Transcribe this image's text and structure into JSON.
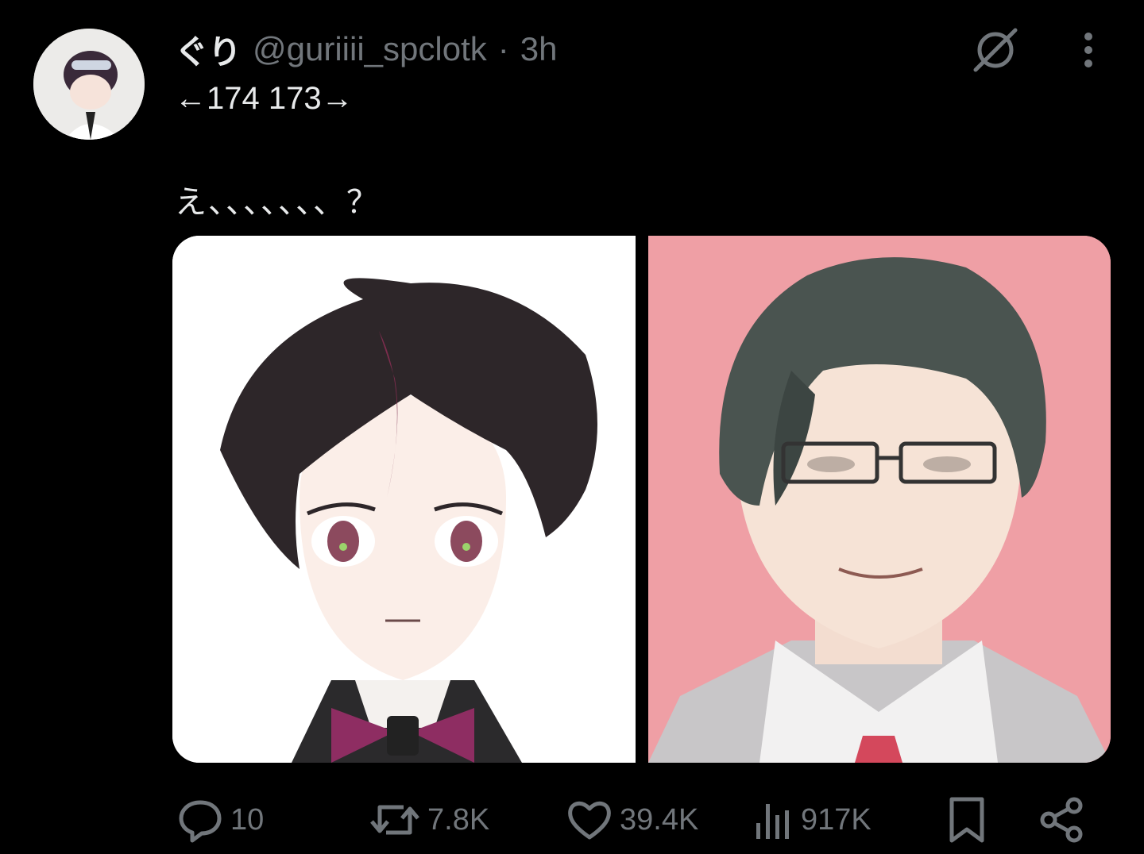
{
  "tweet": {
    "author_name": "ぐり",
    "handle": "@guriiii_spclotk",
    "separator": "·",
    "time": "3h",
    "line1": "←174 173→",
    "line2": "え、、、、、、、？"
  },
  "stats": {
    "replies": "10",
    "reposts": "7.8K",
    "likes": "39.4K",
    "views": "917K"
  },
  "colors": {
    "background": "#000000",
    "text": "#e7e9ea",
    "muted": "#71767b",
    "right_image_bg": "#ef9fa5"
  },
  "icons": [
    "grok-icon",
    "more-icon",
    "reply-icon",
    "repost-icon",
    "like-icon",
    "views-icon",
    "bookmark-icon",
    "share-icon"
  ]
}
